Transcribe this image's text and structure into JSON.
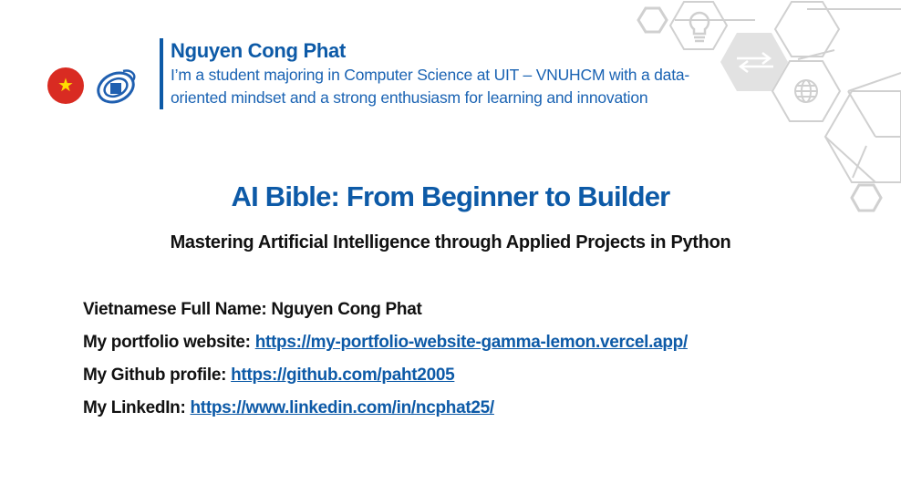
{
  "header": {
    "author_name": "Nguyen Cong Phat",
    "author_bio": "I’m a student majoring in Computer Science at UIT – VNUHCM with a data-oriented mindset and a strong enthusiasm for learning and innovation",
    "flag_star": "★"
  },
  "book": {
    "title": "AI Bible: From Beginner to Builder",
    "subtitle": "Mastering Artificial Intelligence through Applied Projects in Python"
  },
  "info": {
    "full_name_label": "Vietnamese Full Name: Nguyen Cong Phat",
    "portfolio_label": "My portfolio website: ",
    "portfolio_url": "https://my-portfolio-website-gamma-lemon.vercel.app/",
    "github_label": "My Github profile: ",
    "github_url": "https://github.com/paht2005",
    "linkedin_label": "My LinkedIn: ",
    "linkedin_url": "https://www.linkedin.com/in/ncphat25/"
  },
  "decor": {
    "icons": [
      "lightbulb-icon",
      "arrows-exchange-icon",
      "globe-icon"
    ],
    "colors": {
      "accent": "#0d5aa7",
      "hex_line": "#cfcfcf",
      "hex_fill": "#e4e4e4",
      "flag_red": "#d92b22"
    }
  }
}
